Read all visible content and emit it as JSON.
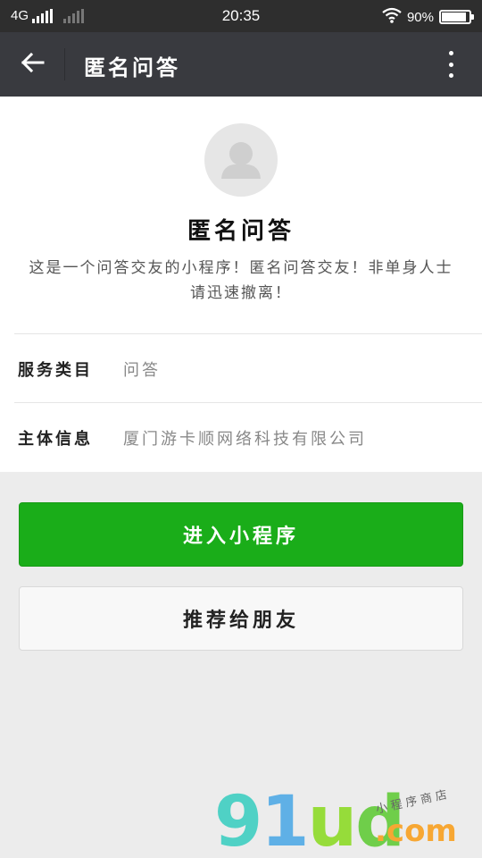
{
  "status_bar": {
    "network": "4G",
    "time": "20:35",
    "battery_text": "90%",
    "battery_level": 0.9
  },
  "title_bar": {
    "back_icon": "arrow-left-icon",
    "title": "匿名问答",
    "more_icon": "more-vertical-icon"
  },
  "profile": {
    "avatar_icon": "user-placeholder-icon",
    "name": "匿名问答",
    "description": "这是一个问答交友的小程序！匿名问答交友！非单身人士请迅速撤离！"
  },
  "info_rows": [
    {
      "label": "服务类目",
      "value": "问答"
    },
    {
      "label": "主体信息",
      "value": "厦门游卡顺网络科技有限公司"
    }
  ],
  "actions": {
    "enter_label": "进入小程序",
    "share_label": "推荐给朋友"
  },
  "watermark": {
    "main_text": "91ud",
    "sub_text": ".com",
    "tag_text": "小程序商店"
  },
  "colors": {
    "status_bar_bg": "#2e2e2e",
    "title_bar_bg": "#393a3f",
    "primary_green": "#1aad19",
    "page_bg": "#ececec"
  }
}
